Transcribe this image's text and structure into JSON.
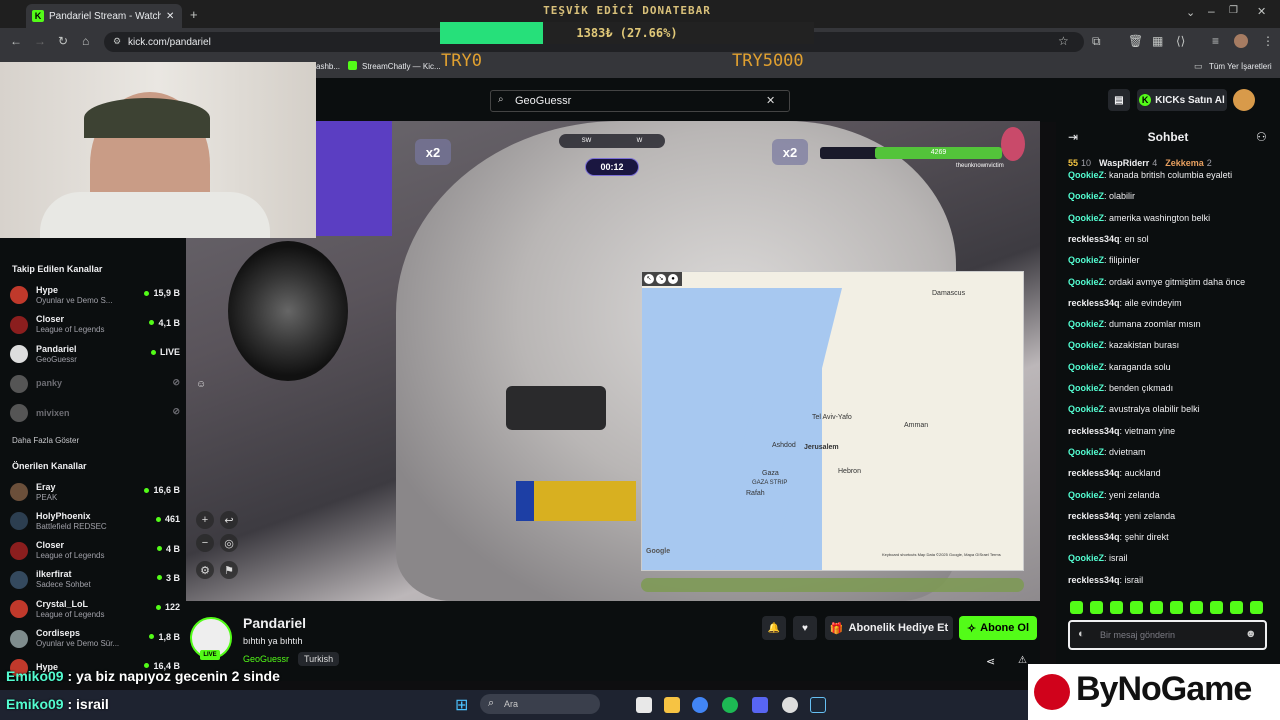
{
  "browser": {
    "tab_title": "Pandariel Stream - Watch L",
    "url": "kick.com/pandariel",
    "bookmarks": [
      "ashb...",
      "StreamChatly — Kic..."
    ],
    "all_bookmarks": "Tüm Yer İşaretleri"
  },
  "donation": {
    "title": "TEŞVİK EDİCİ DONATEBAR",
    "amount": "1383₺ (27.66%)",
    "progress_fraction": 0.2766,
    "start": "TRY0",
    "goal": "TRY5000"
  },
  "header": {
    "search_value": "GeoGuessr",
    "kicks_label": "KICKs Satın Al"
  },
  "sidebar": {
    "followed_heading": "Takip Edilen Kanallar",
    "followed": [
      {
        "name": "Hype",
        "game": "Oyunlar ve Demo S...",
        "viewers": "15,9 B",
        "color": "#c0392b"
      },
      {
        "name": "Closer",
        "game": "League of Legends",
        "viewers": "4,1 B",
        "color": "#8b1e1e"
      },
      {
        "name": "Pandariel",
        "game": "GeoGuessr",
        "viewers": "LIVE",
        "color": "#dddddd"
      },
      {
        "name": "panky",
        "game": "",
        "viewers": "",
        "color": "#555555"
      },
      {
        "name": "mivixen",
        "game": "",
        "viewers": "",
        "color": "#555555"
      }
    ],
    "show_more": "Daha Fazla Göster",
    "recommended_heading": "Önerilen Kanallar",
    "recommended": [
      {
        "name": "Eray",
        "game": "PEAK",
        "viewers": "16,6 B",
        "color": "#6b4f3a"
      },
      {
        "name": "HolyPhoenix",
        "game": "Battlefield REDSEC",
        "viewers": "461",
        "color": "#2c3e50"
      },
      {
        "name": "Closer",
        "game": "League of Legends",
        "viewers": "4 B",
        "color": "#8b1e1e"
      },
      {
        "name": "ilkerfirat",
        "game": "Sadece Sohbet",
        "viewers": "3 B",
        "color": "#34495e"
      },
      {
        "name": "Crystal_LoL",
        "game": "League of Legends",
        "viewers": "122",
        "color": "#c0392b"
      },
      {
        "name": "Cordiseps",
        "game": "Oyunlar ve Demo Sür...",
        "viewers": "1,8 B",
        "color": "#7f8c8d"
      },
      {
        "name": "Hype",
        "game": "",
        "viewers": "16,4 B",
        "color": "#c0392b"
      }
    ]
  },
  "game_hud": {
    "mult_left": "x2",
    "mult_right": "x2",
    "compass_sw": "SW",
    "compass_w": "W",
    "timer": "00:12",
    "score": "4269",
    "player": "theunknownvictim"
  },
  "map": {
    "labels": [
      "Damascus",
      "Tel Aviv-Yafo",
      "Amman",
      "Ashdod",
      "Jerusalem",
      "Hebron",
      "Gaza",
      "GAZA STRIP",
      "Rafah"
    ],
    "attribution": "Keyboard shortcuts   Map Data ©2025 Google, Mapa GISrael   Terms",
    "google": "Google"
  },
  "stream": {
    "name": "Pandariel",
    "title": "bıhtıh ya bıhtıh",
    "category": "GeoGuessr",
    "tag": "Turkish",
    "live": "LIVE",
    "gift_label": "Abonelik Hediye Et",
    "subscribe_label": "Abone Ol"
  },
  "chat": {
    "heading": "Sohbet",
    "top_gifters": [
      {
        "name": "55",
        "count": "10"
      },
      {
        "name": "WaspRiderr",
        "count": "4"
      },
      {
        "name": "Zekkema",
        "count": "2"
      }
    ],
    "messages": [
      {
        "user": "QookieZ",
        "text": "kanada british columbia eyaleti",
        "color": "#53fcd0"
      },
      {
        "user": "QookieZ",
        "text": "olabilir",
        "color": "#53fcd0"
      },
      {
        "user": "QookieZ",
        "text": "amerika washington belki",
        "color": "#53fcd0"
      },
      {
        "user": "reckless34q",
        "text": "en sol",
        "color": "#efeff1"
      },
      {
        "user": "QookieZ",
        "text": "filipinler",
        "color": "#53fcd0"
      },
      {
        "user": "QookieZ",
        "text": "ordaki avmye gitmiştim daha önce",
        "color": "#53fcd0"
      },
      {
        "user": "reckless34q",
        "text": "aile evindeyim",
        "color": "#efeff1"
      },
      {
        "user": "QookieZ",
        "text": "dumana zoomlar mısın",
        "color": "#53fcd0"
      },
      {
        "user": "QookieZ",
        "text": "kazakistan burası",
        "color": "#53fcd0"
      },
      {
        "user": "QookieZ",
        "text": "karaganda solu",
        "color": "#53fcd0"
      },
      {
        "user": "QookieZ",
        "text": "benden çıkmadı",
        "color": "#53fcd0"
      },
      {
        "user": "QookieZ",
        "text": "avustralya olabilir belki",
        "color": "#53fcd0"
      },
      {
        "user": "reckless34q",
        "text": "vietnam yine",
        "color": "#efeff1"
      },
      {
        "user": "QookieZ",
        "text": "dvietnam",
        "color": "#53fcd0"
      },
      {
        "user": "reckless34q",
        "text": "auckland",
        "color": "#efeff1"
      },
      {
        "user": "QookieZ",
        "text": "yeni zelanda",
        "color": "#53fcd0"
      },
      {
        "user": "reckless34q",
        "text": "yeni zelanda",
        "color": "#efeff1"
      },
      {
        "user": "reckless34q",
        "text": "şehir direkt",
        "color": "#efeff1"
      },
      {
        "user": "QookieZ",
        "text": "israil",
        "color": "#53fcd0"
      },
      {
        "user": "reckless34q",
        "text": "israil",
        "color": "#efeff1"
      }
    ],
    "input_placeholder": "Bir mesaj gönderin"
  },
  "overlay": [
    {
      "user": "Emiko09",
      "text": " : ya biz napıyoz gecenin 2 sinde"
    },
    {
      "user": "Emiko09",
      "text": " : israil"
    }
  ],
  "taskbar": {
    "search": "Ara"
  },
  "brand": {
    "name": "ByNoGame"
  }
}
